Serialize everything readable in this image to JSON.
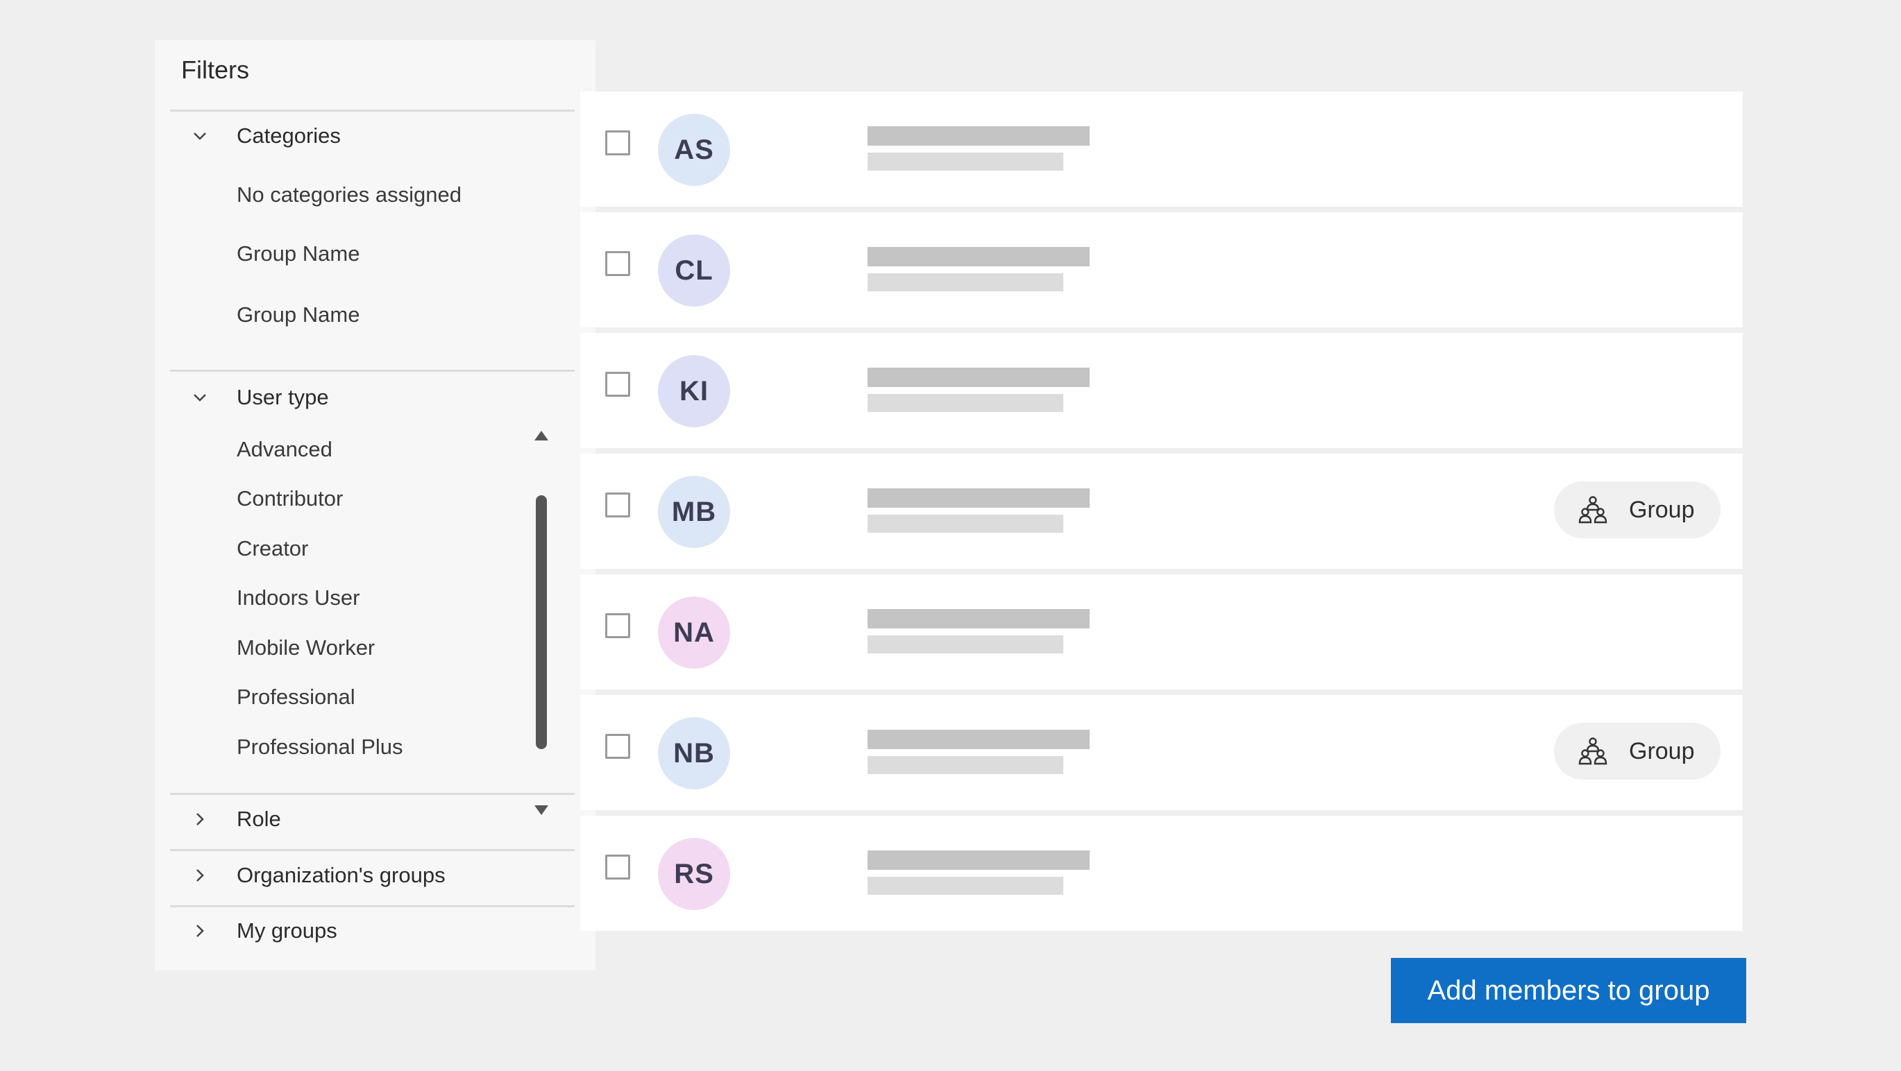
{
  "filters": {
    "title": "Filters",
    "categories": {
      "label": "Categories",
      "items": [
        "No categories assigned",
        "Group Name",
        "Group Name"
      ]
    },
    "user_type": {
      "label": "User type",
      "items": [
        "Advanced",
        "Contributor",
        "Creator",
        "Indoors User",
        "Mobile Worker",
        "Professional",
        "Professional Plus"
      ]
    },
    "collapsed_sections": [
      "Role",
      "Organization's groups",
      "My groups"
    ]
  },
  "members": [
    {
      "initials": "AS",
      "avatar_color": "#dbe7f6",
      "chip": null
    },
    {
      "initials": "CL",
      "avatar_color": "#dcdff6",
      "chip": null
    },
    {
      "initials": "KI",
      "avatar_color": "#dcdff6",
      "chip": null
    },
    {
      "initials": "MB",
      "avatar_color": "#dbe7f6",
      "chip": "Group"
    },
    {
      "initials": "NA",
      "avatar_color": "#f3d9f1",
      "chip": null
    },
    {
      "initials": "NB",
      "avatar_color": "#dbe7f6",
      "chip": "Group"
    },
    {
      "initials": "RS",
      "avatar_color": "#f3d9f1",
      "chip": null
    }
  ],
  "actions": {
    "add_members_label": "Add members to group",
    "primary_color": "#0f6fc6"
  }
}
